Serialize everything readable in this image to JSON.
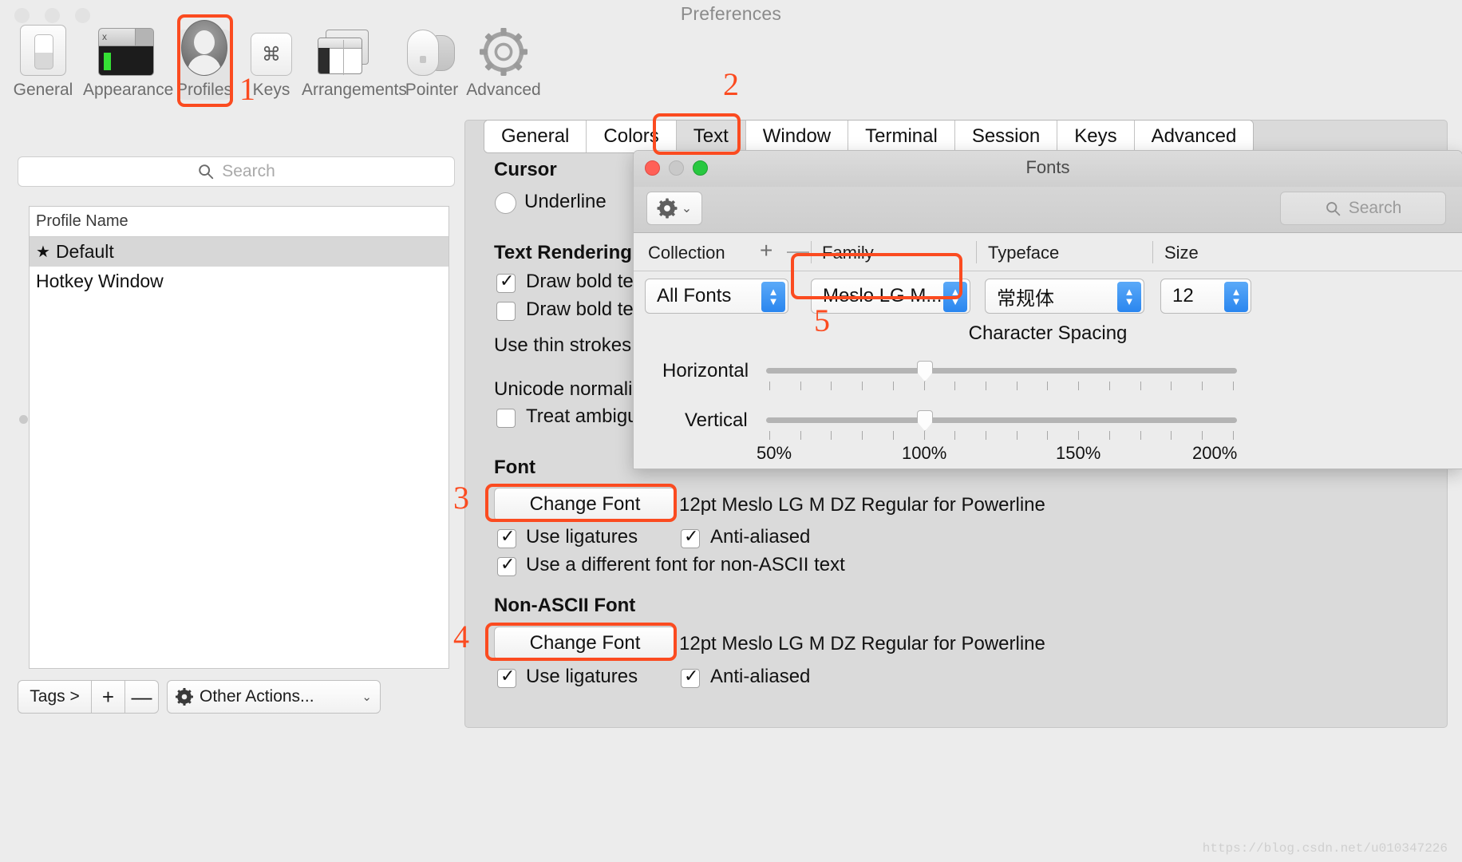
{
  "window": {
    "title": "Preferences"
  },
  "toolbar": {
    "items": [
      {
        "label": "General",
        "icon": "general-switch-icon"
      },
      {
        "label": "Appearance",
        "icon": "terminal-window-icon"
      },
      {
        "label": "Profiles",
        "icon": "user-avatar-icon"
      },
      {
        "label": "Keys",
        "icon": "command-key-icon"
      },
      {
        "label": "Arrangements",
        "icon": "windows-stack-icon"
      },
      {
        "label": "Pointer",
        "icon": "mouse-icon"
      },
      {
        "label": "Advanced",
        "icon": "gear-icon"
      }
    ],
    "selected": "Profiles"
  },
  "sidebar": {
    "search": {
      "placeholder": "Search",
      "value": "",
      "icon": "search-icon"
    },
    "table": {
      "column_header": "Profile Name",
      "rows": [
        {
          "star": "★",
          "name": "Default",
          "selected": true
        },
        {
          "star": "",
          "name": "Hotkey Window",
          "selected": false
        }
      ]
    },
    "bottom_bar": {
      "tags_label": "Tags >",
      "add_label": "+",
      "remove_label": "—",
      "other_actions_label": "Other Actions...",
      "other_actions_caret": "⌄",
      "gear_icon": "gear-icon"
    }
  },
  "tabs": {
    "items": [
      "General",
      "Colors",
      "Text",
      "Window",
      "Terminal",
      "Session",
      "Keys",
      "Advanced"
    ],
    "active": "Text"
  },
  "text_pane": {
    "cursor": {
      "title": "Cursor",
      "underline_label": "Underline",
      "underline_checked": false
    },
    "text_rendering": {
      "title": "Text Rendering",
      "draw_bold_1": "Draw bold tex",
      "draw_bold_1_checked": true,
      "draw_bold_2": "Draw bold tex",
      "draw_bold_2_checked": false,
      "thin_strokes": "Use thin strokes",
      "unicode_norm": "Unicode normaliz",
      "treat_ambiguous": "Treat ambiguo",
      "treat_ambiguous_checked": false
    },
    "font": {
      "title": "Font",
      "change_font_label": "Change Font",
      "description": "12pt Meslo LG M DZ Regular for Powerline",
      "use_ligatures_label": "Use ligatures",
      "use_ligatures_checked": true,
      "anti_aliased_label": "Anti-aliased",
      "anti_aliased_checked": true,
      "different_font_label": "Use a different font for non-ASCII text",
      "different_font_checked": true
    },
    "non_ascii_font": {
      "title": "Non-ASCII Font",
      "change_font_label": "Change Font",
      "description": "12pt Meslo LG M DZ Regular for Powerline",
      "use_ligatures_label": "Use ligatures",
      "use_ligatures_checked": true,
      "anti_aliased_label": "Anti-aliased",
      "anti_aliased_checked": true
    }
  },
  "fonts_panel": {
    "title": "Fonts",
    "gear_icon": "gear-icon",
    "gear_caret": "⌄",
    "search": {
      "placeholder": "Search",
      "value": "",
      "icon": "search-icon"
    },
    "columns": {
      "collection": "Collection",
      "add": "+",
      "remove": "—",
      "family": "Family",
      "typeface": "Typeface",
      "size": "Size"
    },
    "values": {
      "collection": "All Fonts",
      "family": "Meslo LG M...",
      "typeface": "常规体",
      "size": "12"
    },
    "character_spacing": {
      "title": "Character Spacing",
      "horizontal_label": "Horizontal",
      "vertical_label": "Vertical",
      "horizontal_value": "100%",
      "vertical_value": "100%",
      "scale": [
        "50%",
        "100%",
        "150%",
        "200%"
      ]
    }
  },
  "annotations": {
    "accent_color": "#fb4b20",
    "markers": [
      {
        "id": "1",
        "target": "Profiles toolbar item"
      },
      {
        "id": "2",
        "target": "Text tab"
      },
      {
        "id": "3",
        "target": "Font Change Font button"
      },
      {
        "id": "4",
        "target": "Non-ASCII Font Change Font button"
      },
      {
        "id": "5",
        "target": "Family dropdown"
      }
    ]
  },
  "watermark": "https://blog.csdn.net/u010347226"
}
